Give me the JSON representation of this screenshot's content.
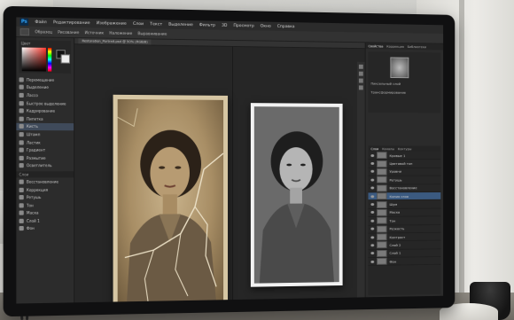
{
  "menu": {
    "items": [
      "Файл",
      "Редактирование",
      "Изображение",
      "Слои",
      "Текст",
      "Выделение",
      "Фильтр",
      "3D",
      "Просмотр",
      "Окно",
      "Справка"
    ]
  },
  "colors": {
    "background": "#3a3a3a",
    "panel": "#2c2c2c",
    "selection": "#3b5a80",
    "accent_blue": "#31a8ff"
  },
  "options_bar": {
    "items": [
      "Образец",
      "Рисование",
      "Источник",
      "Наложение",
      "Выравнивание"
    ]
  },
  "left_panel": {
    "color_label": "Цвет",
    "tools": [
      "Перемещение",
      "Выделение",
      "Лассо",
      "Быстрое выделение",
      "Кадрирование",
      "Пипетка",
      "Кисть",
      "Штамп",
      "Ластик",
      "Градиент",
      "Размытие",
      "Осветлитель"
    ],
    "lower_head": "Слои",
    "lower_items": [
      "Восстановление",
      "Коррекция",
      "Ретушь",
      "Тон",
      "Маска",
      "Слой 1",
      "Фон"
    ]
  },
  "document": {
    "tab": "Restoration_Portrait.psd @ 50% (RGB/8)"
  },
  "right_panel": {
    "tabs": [
      "Свойства",
      "Коррекция",
      "Библиотеки"
    ],
    "props_labels": [
      "Пиксельный слой",
      "Трансформирование"
    ],
    "layer_tabs": [
      "Слои",
      "Каналы",
      "Контуры"
    ],
    "layers": [
      {
        "name": "Кривые 1",
        "selected": false
      },
      {
        "name": "Цветовой тон",
        "selected": false
      },
      {
        "name": "Уровни",
        "selected": false
      },
      {
        "name": "Ретушь",
        "selected": false
      },
      {
        "name": "Восстановление",
        "selected": false
      },
      {
        "name": "Копия слоя",
        "selected": true
      },
      {
        "name": "Шум",
        "selected": false
      },
      {
        "name": "Маска",
        "selected": false
      },
      {
        "name": "Тон",
        "selected": false
      },
      {
        "name": "Резкость",
        "selected": false
      },
      {
        "name": "Контраст",
        "selected": false
      },
      {
        "name": "Слой 2",
        "selected": false
      },
      {
        "name": "Слой 1",
        "selected": false
      },
      {
        "name": "Фон",
        "selected": false
      }
    ]
  }
}
